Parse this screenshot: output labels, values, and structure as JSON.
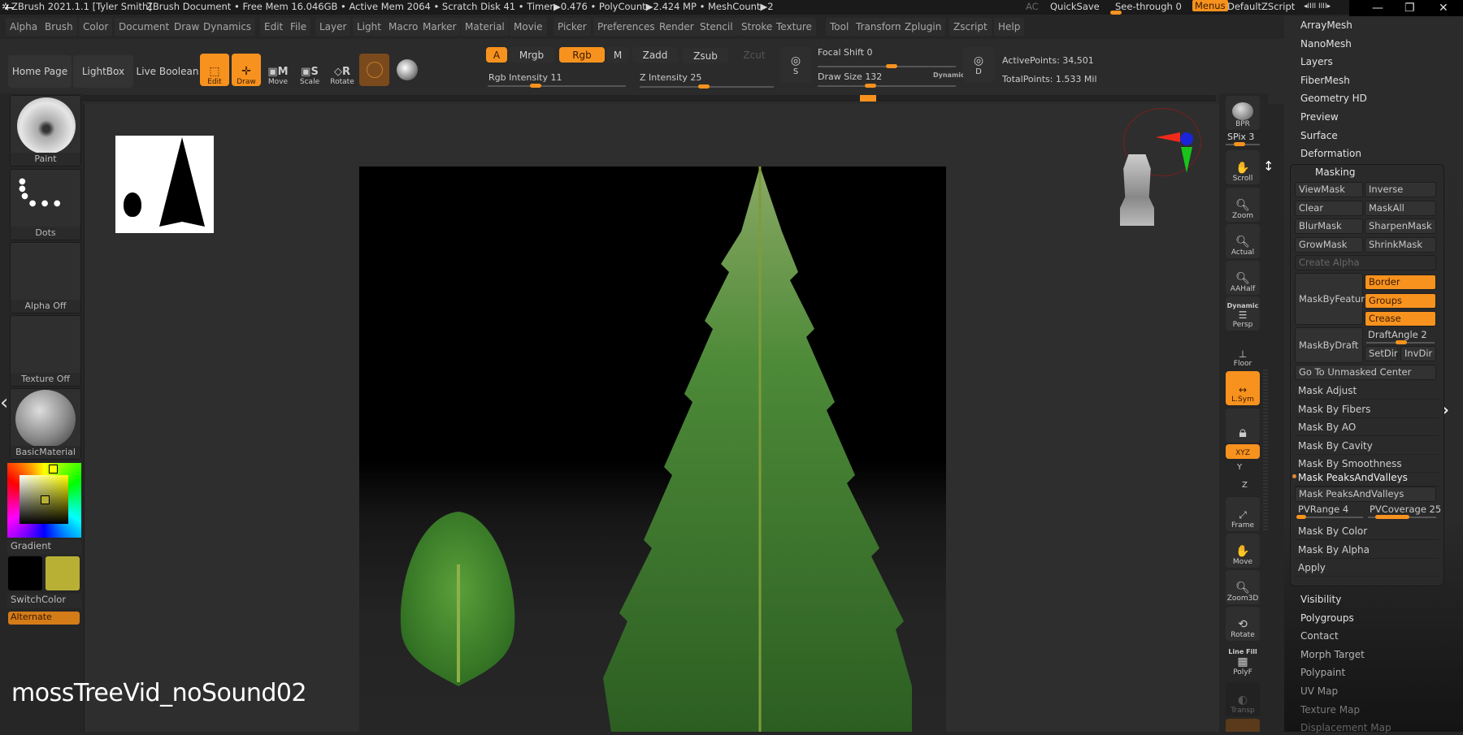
{
  "titlebar": {
    "app": "ZBrush 2021.1.1 [Tyler Smith]",
    "doc": "ZBrush Document",
    "stats": "• Free Mem 16.046GB • Active Mem 2064 • Scratch Disk 41 • Timer▶0.476 • PolyCount▶2.424 MP  • MeshCount▶2",
    "ac": "AC",
    "quicksave": "QuickSave",
    "seethrough": "See-through",
    "seethrough_value": "0",
    "menus": "Menus",
    "script": "DefaultZScript",
    "arrows": "◂IIII IIII▸"
  },
  "window_controls": {
    "minimize": "—",
    "restore": "❐",
    "close": "✕"
  },
  "menubar": [
    "Alpha",
    "Brush",
    "Color",
    "Document",
    "Draw",
    "Dynamics",
    "Edit",
    "File",
    "Layer",
    "Light",
    "Macro",
    "Marker",
    "Material",
    "Movie",
    "Picker",
    "Preferences",
    "Render",
    "Stencil",
    "Stroke",
    "Texture",
    "Tool",
    "Transform",
    "Zplugin",
    "Zscript",
    "Help"
  ],
  "toolbar": {
    "home": "Home Page",
    "lightbox": "LightBox",
    "liveboolean": "Live Boolean",
    "edit": "Edit",
    "draw": "Draw",
    "move": "Move",
    "scale": "Scale",
    "rotate": "Rotate",
    "a": "A",
    "mrgb": "Mrgb",
    "rgb": "Rgb",
    "m": "M",
    "zadd": "Zadd",
    "zsub": "Zsub",
    "zcut": "Zcut",
    "rgb_intensity_label": "Rgb Intensity",
    "rgb_intensity": "11",
    "z_intensity_label": "Z Intensity",
    "z_intensity": "25",
    "focal_label": "Focal Shift",
    "focal": "0",
    "drawsize_label": "Draw Size",
    "drawsize": "132",
    "dynamic": "Dynamic",
    "s": "S",
    "d": "D",
    "active_points": "ActivePoints: 34,501",
    "total_points": "TotalPoints: 1.533 Mil"
  },
  "leftpanel": {
    "brush": "Paint",
    "stroke": "Dots",
    "alpha": "Alpha Off",
    "texture": "Texture Off",
    "material": "BasicMaterial",
    "gradient": "Gradient",
    "switchcolor": "SwitchColor",
    "alternate": "Alternate",
    "main_color": "#b8b034",
    "secondary_color": "#000000"
  },
  "rightshelf": {
    "bpr": "BPR",
    "spix": "SPix 3",
    "scroll": "Scroll",
    "zoom": "Zoom",
    "actual": "Actual",
    "aahalf": "AAHalf",
    "dynamic": "Dynamic",
    "persp": "Persp",
    "floor": "Floor",
    "lsym": "L.Sym",
    "xyz": "XYZ",
    "y": "Y",
    "z": "Z",
    "frame": "Frame",
    "move": "Move",
    "zoom3d": "Zoom3D",
    "rotate": "Rotate",
    "linefill": "Line Fill",
    "polyf": "PolyF",
    "transp": "Transp"
  },
  "tray": {
    "top_items": [
      "ArrayMesh",
      "NanoMesh",
      "Layers",
      "FiberMesh",
      "Geometry HD",
      "Preview",
      "Surface",
      "Deformation"
    ],
    "masking": {
      "title": "Masking",
      "grid": [
        [
          "ViewMask",
          "Inverse"
        ],
        [
          "Clear",
          "MaskAll"
        ],
        [
          "BlurMask",
          "SharpenMask"
        ],
        [
          "GrowMask",
          "ShrinkMask"
        ]
      ],
      "create_alpha": "Create Alpha",
      "maskbyfeature": "MaskByFeature",
      "feature_opts": [
        "Border",
        "Groups",
        "Crease"
      ],
      "maskbydraft": "MaskByDraft",
      "draftangle": "DraftAngle 2",
      "setdir": "SetDir",
      "invdir": "InvDir",
      "goto": "Go To Unmasked Center",
      "subs": [
        "Mask Adjust",
        "Mask By Fibers",
        "Mask By AO",
        "Mask By Cavity",
        "Mask By Smoothness"
      ],
      "peaks_header": "Mask PeaksAndValleys",
      "peaks_button": "Mask PeaksAndValleys",
      "pvrange": "PVRange 4",
      "pvcoverage": "PVCoverage 25",
      "subs2": [
        "Mask By Color",
        "Mask By Alpha",
        "Apply"
      ]
    },
    "bottom_items": [
      "Visibility",
      "Polygroups",
      "Contact",
      "Morph Target",
      "Polypaint",
      "UV Map",
      "Texture Map",
      "Displacement Map"
    ]
  },
  "caption": "mossTreeVid_noSound02"
}
